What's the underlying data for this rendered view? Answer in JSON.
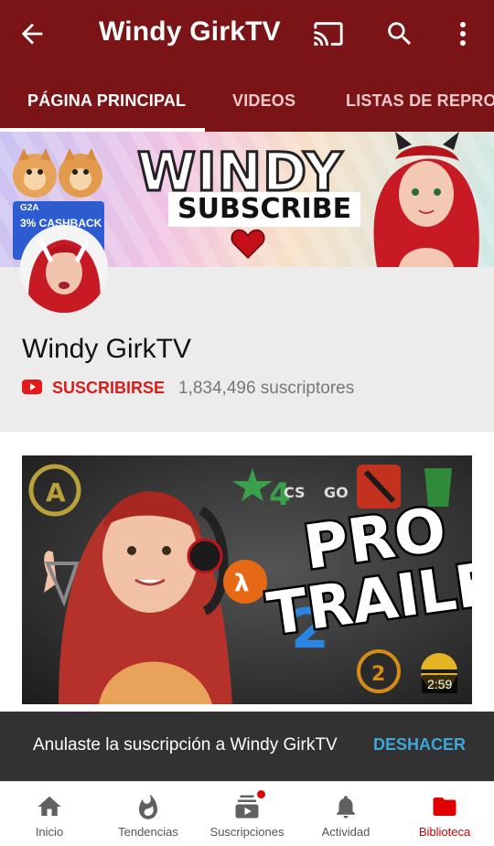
{
  "appbar": {
    "title": "Windy GirkTV",
    "icons": [
      "back-arrow-icon",
      "cast-icon",
      "search-icon",
      "more-vert-icon"
    ]
  },
  "tabs": [
    {
      "label": "PÁGINA PRINCIPAL",
      "active": true
    },
    {
      "label": "VIDEOS",
      "active": false
    },
    {
      "label": "LISTAS DE REPROD",
      "active": false
    }
  ],
  "banner": {
    "title": "WINDY",
    "subtitle": "SUBSCRIBE",
    "promo": "3% CASHBACK",
    "promo_brand": "G2A"
  },
  "channel": {
    "name": "Windy GirkTV",
    "subscribe_label": "SUSCRIBIRSE",
    "subscriber_count": "1,834,496 suscriptores"
  },
  "video": {
    "duration": "2:59",
    "thumb_text": [
      "PRO",
      "TRAILER"
    ]
  },
  "snackbar": {
    "message": "Anulaste la suscripción a Windy GirkTV",
    "action": "DESHACER"
  },
  "bottom_nav": [
    {
      "label": "Inicio",
      "icon": "home-icon",
      "active": false
    },
    {
      "label": "Tendencias",
      "icon": "flame-icon",
      "active": false
    },
    {
      "label": "Suscripciones",
      "icon": "subscriptions-icon",
      "active": false,
      "badge": true
    },
    {
      "label": "Actividad",
      "icon": "bell-icon",
      "active": false
    },
    {
      "label": "Biblioteca",
      "icon": "folder-icon",
      "active": true
    }
  ],
  "colors": {
    "brand": "#7b1416",
    "accent_red": "#d91c1c",
    "snackbar_action": "#3ea6d8"
  }
}
